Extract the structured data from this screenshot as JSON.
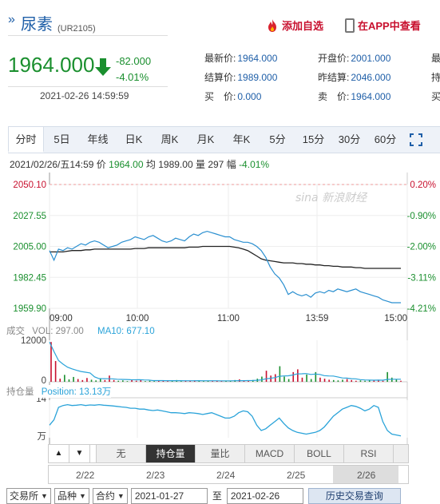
{
  "header": {
    "name": "尿素",
    "code": "(UR2105)",
    "add_favorite": "添加自选",
    "app_view": "在APP中查看"
  },
  "quote": {
    "price": "1964.000",
    "change": "-82.000",
    "change_pct": "-4.01%",
    "time": "2021-02-26 14:59:59"
  },
  "stats": [
    {
      "label": "最新价:",
      "value": "1964.000"
    },
    {
      "label": "结算价:",
      "value": "1989.000"
    },
    {
      "label": "买　价:",
      "value": "0.000"
    },
    {
      "label": "开盘价:",
      "value": "2001.000"
    },
    {
      "label": "昨结算:",
      "value": "2046.000"
    },
    {
      "label": "卖　价:",
      "value": "1964.000"
    },
    {
      "label": "最"
    },
    {
      "label": "持"
    },
    {
      "label": "买"
    }
  ],
  "tabs": [
    "分时",
    "5日",
    "年线",
    "日K",
    "周K",
    "月K",
    "年K",
    "5分",
    "15分",
    "30分",
    "60分"
  ],
  "infoline": {
    "datetime": "2021/02/26/五14:59",
    "price_label": "价",
    "price": "1964.00",
    "avg_label": "均",
    "avg": "1989.00",
    "vol_label": "量",
    "vol": "297",
    "amp_label": "幅",
    "amp": "-4.01%"
  },
  "chart_data": {
    "type": "line",
    "y_ticks": [
      "2050.10",
      "2027.55",
      "2005.00",
      "1982.45",
      "1959.90"
    ],
    "pct_ticks": [
      "0.20%",
      "-0.90%",
      "-2.00%",
      "-3.11%",
      "-4.21%"
    ],
    "x_ticks": [
      "09:00",
      "10:00",
      "11:00",
      "13:59",
      "15:00"
    ],
    "ylim": [
      1959.9,
      2050.1
    ],
    "price_series": [
      2002,
      1995,
      2003,
      2002,
      2004,
      2003,
      2005,
      2007,
      2006,
      2008,
      2009,
      2008,
      2006,
      2004,
      2005,
      2006,
      2008,
      2009,
      2010,
      2012,
      2011,
      2010,
      2012,
      2013,
      2011,
      2009,
      2008,
      2009,
      2011,
      2010,
      2009,
      2012,
      2014,
      2013,
      2015,
      2016,
      2015,
      2014,
      2013,
      2012,
      2012,
      2010,
      2009,
      2008,
      2008,
      2007,
      2005,
      2002,
      1997,
      1990,
      1985,
      1982,
      1977,
      1970,
      1972,
      1970,
      1969,
      1970,
      1968,
      1971,
      1972,
      1971,
      1973,
      1972,
      1974,
      1973,
      1972,
      1973,
      1974,
      1972,
      1971,
      1970,
      1969,
      1968,
      1966,
      1965,
      1964,
      1964,
      1964
    ],
    "avg_series": [
      2001,
      2001,
      2001,
      2001,
      2001.5,
      2002,
      2002,
      2002,
      2002.5,
      2002.5,
      2003,
      2003,
      2003,
      2003,
      2003,
      2003,
      2003,
      2003,
      2003,
      2003.5,
      2003.5,
      2003.5,
      2004,
      2004,
      2004,
      2004,
      2004,
      2004,
      2004,
      2004,
      2004,
      2004.5,
      2004.5,
      2004.5,
      2005,
      2005,
      2005,
      2005,
      2005,
      2005,
      2005,
      2004.5,
      2004,
      2003,
      2002,
      2000,
      1998,
      1996,
      1995,
      1994.5,
      1994,
      1993.5,
      1993,
      1993,
      1993,
      1992.5,
      1992.5,
      1992,
      1992,
      1991.5,
      1991.5,
      1991,
      1991,
      1990.5,
      1990.5,
      1990,
      1990,
      1990,
      1989.5,
      1989.5,
      1989,
      1989,
      1989,
      1989,
      1989,
      1989,
      1989,
      1989,
      1989
    ],
    "volume_header": {
      "label": "成交",
      "vol": "VOL: 297.00",
      "ma": "MA10: 677.10"
    },
    "volume_ticks": [
      "12000",
      "0"
    ],
    "volume_series": [
      11500,
      6000,
      900,
      2000,
      700,
      1400,
      800,
      500,
      1100,
      600,
      400,
      900,
      500,
      1800,
      500,
      300,
      400,
      200,
      500,
      300,
      600,
      200,
      300,
      200,
      400,
      300,
      200,
      300,
      500,
      200,
      300,
      300,
      400,
      300,
      200,
      300,
      200,
      300,
      200,
      300,
      300,
      500,
      700,
      300,
      400,
      500,
      900,
      1500,
      3200,
      1800,
      2200,
      4500,
      1500,
      800,
      2800,
      3600,
      1200,
      2100,
      800,
      2800,
      1200,
      900,
      600,
      500,
      400,
      600,
      800,
      500,
      300,
      400,
      300,
      500,
      400,
      600,
      300,
      2800,
      1200,
      700,
      300
    ],
    "position_header": {
      "label": "持仓量",
      "value": "Position: 13.13万"
    },
    "position_ticks": [
      "14",
      "万"
    ],
    "position_series": [
      12.6,
      12.9,
      13.6,
      13.7,
      13.75,
      13.7,
      13.72,
      13.75,
      13.7,
      13.73,
      13.72,
      13.75,
      13.72,
      13.7,
      13.68,
      13.65,
      13.62,
      13.6,
      13.55,
      13.55,
      13.5,
      13.5,
      13.45,
      13.42,
      13.45,
      13.4,
      13.35,
      13.3,
      13.3,
      13.28,
      13.25,
      13.3,
      13.28,
      13.25,
      13.2,
      13.25,
      13.3,
      13.2,
      13.1,
      13.0,
      13.0,
      13.1,
      13.3,
      13.4,
      13.35,
      13.1,
      12.6,
      12.3,
      12.4,
      12.6,
      12.8,
      13.0,
      12.7,
      12.45,
      12.3,
      12.2,
      12.15,
      12.1,
      12.15,
      12.2,
      12.3,
      12.5,
      12.8,
      13.1,
      13.3,
      13.5,
      13.6,
      13.7,
      13.65,
      13.55,
      13.4,
      13.5,
      13.7,
      13.6,
      12.8,
      12.3,
      12.1,
      12.05,
      12.0
    ]
  },
  "indicators": {
    "prev": "▲",
    "next": "▼",
    "items": [
      "无",
      "持仓量",
      "量比",
      "MACD",
      "BOLL",
      "RSI"
    ],
    "selected": "持仓量"
  },
  "date_axis": [
    "2/22",
    "2/23",
    "2/24",
    "2/25",
    "2/26"
  ],
  "controls": {
    "exchange": "交易所",
    "variety": "品种",
    "contract": "合约",
    "start_date": "2021-01-27",
    "to": "至",
    "end_date": "2021-02-26",
    "query": "历史交易查询"
  }
}
